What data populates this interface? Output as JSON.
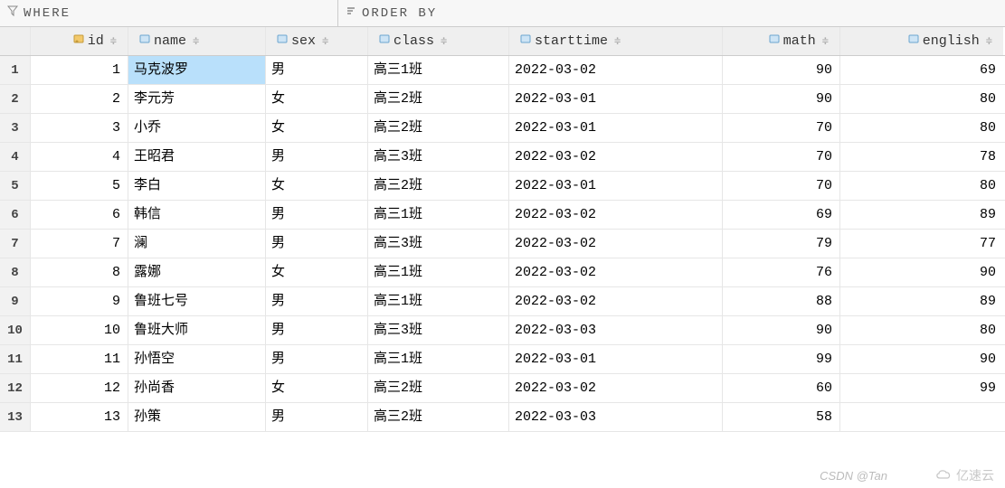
{
  "toolbar": {
    "where_label": "WHERE",
    "orderby_label": "ORDER BY"
  },
  "columns": {
    "id": "id",
    "name": "name",
    "sex": "sex",
    "class": "class",
    "starttime": "starttime",
    "math": "math",
    "english": "english"
  },
  "rows": [
    {
      "n": "1",
      "id": "1",
      "name": "马克波罗",
      "sex": "男",
      "class": "高三1班",
      "starttime": "2022-03-02",
      "math": "90",
      "english": "69"
    },
    {
      "n": "2",
      "id": "2",
      "name": "李元芳",
      "sex": "女",
      "class": "高三2班",
      "starttime": "2022-03-01",
      "math": "90",
      "english": "80"
    },
    {
      "n": "3",
      "id": "3",
      "name": "小乔",
      "sex": "女",
      "class": "高三2班",
      "starttime": "2022-03-01",
      "math": "70",
      "english": "80"
    },
    {
      "n": "4",
      "id": "4",
      "name": "王昭君",
      "sex": "男",
      "class": "高三3班",
      "starttime": "2022-03-02",
      "math": "70",
      "english": "78"
    },
    {
      "n": "5",
      "id": "5",
      "name": "李白",
      "sex": "女",
      "class": "高三2班",
      "starttime": "2022-03-01",
      "math": "70",
      "english": "80"
    },
    {
      "n": "6",
      "id": "6",
      "name": "韩信",
      "sex": "男",
      "class": "高三1班",
      "starttime": "2022-03-02",
      "math": "69",
      "english": "89"
    },
    {
      "n": "7",
      "id": "7",
      "name": "澜",
      "sex": "男",
      "class": "高三3班",
      "starttime": "2022-03-02",
      "math": "79",
      "english": "77"
    },
    {
      "n": "8",
      "id": "8",
      "name": "露娜",
      "sex": "女",
      "class": "高三1班",
      "starttime": "2022-03-02",
      "math": "76",
      "english": "90"
    },
    {
      "n": "9",
      "id": "9",
      "name": "鲁班七号",
      "sex": "男",
      "class": "高三1班",
      "starttime": "2022-03-02",
      "math": "88",
      "english": "89"
    },
    {
      "n": "10",
      "id": "10",
      "name": "鲁班大师",
      "sex": "男",
      "class": "高三3班",
      "starttime": "2022-03-03",
      "math": "90",
      "english": "80"
    },
    {
      "n": "11",
      "id": "11",
      "name": "孙悟空",
      "sex": "男",
      "class": "高三1班",
      "starttime": "2022-03-01",
      "math": "99",
      "english": "90"
    },
    {
      "n": "12",
      "id": "12",
      "name": "孙尚香",
      "sex": "女",
      "class": "高三2班",
      "starttime": "2022-03-02",
      "math": "60",
      "english": "99"
    },
    {
      "n": "13",
      "id": "13",
      "name": "孙策",
      "sex": "男",
      "class": "高三2班",
      "starttime": "2022-03-03",
      "math": "58",
      "english": ""
    }
  ],
  "watermark1": "CSDN @Tan",
  "watermark2": "亿速云"
}
